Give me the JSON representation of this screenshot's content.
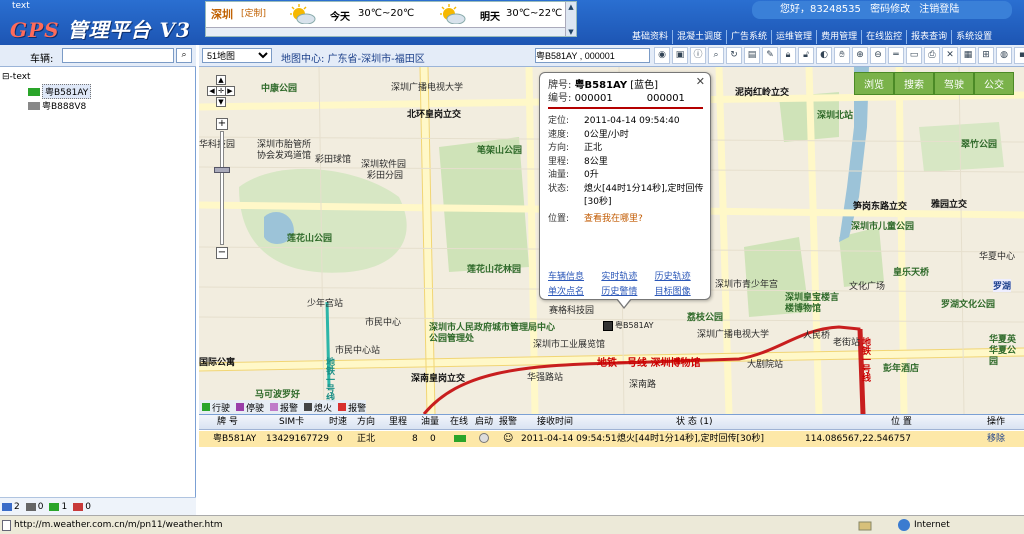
{
  "page_label": "text",
  "app": {
    "title_prefix": "GPS",
    "title_rest": " 管理平台 V3"
  },
  "weather": {
    "city": "深圳",
    "forecast_link": "[定制]",
    "today_label": "今天",
    "today_temp": "30℃~20℃",
    "tomorrow_label": "明天",
    "tomorrow_temp": "30℃~22℃"
  },
  "greeting": {
    "text": "您好，83248535",
    "change_pwd": "密码修改",
    "logout": "注销登陆"
  },
  "nav": [
    "基础资料",
    "混凝土调度",
    "广告系统",
    "运维管理",
    "费用管理",
    "在线监控",
    "报表查询",
    "系统设置"
  ],
  "sidebar": {
    "vehicle_label": "车辆:",
    "vehicle_value": "",
    "tree_root": "text",
    "vehicles": [
      {
        "plate": "粤B581AY"
      },
      {
        "plate": "粤B888V8"
      }
    ],
    "status_counts": [
      "2",
      "0",
      "1",
      "0"
    ]
  },
  "mapbar": {
    "map_type": "51地图",
    "center_label": "地图中心: 广东省-深圳市-福田区",
    "target_input": "粤B581AY , 000001"
  },
  "map_tabs": [
    "浏览",
    "搜索",
    "驾驶",
    "公交"
  ],
  "map_labels": [
    "中康公园",
    "深圳广播电视大学",
    "北环皇岗立交",
    "深圳市胎管所",
    "协会发鸡道馆",
    "彩田球馆",
    "深圳软件园",
    "彩田分园",
    "笔架山公园",
    "华科技园",
    "莲花山公园",
    "莲花山花林园",
    "少年宫站",
    "市民中心站",
    "深圳市人民政府城市管理局中心公园管理处",
    "深圳市工业展览馆",
    "赛格科技园",
    "市民中心",
    "深南皇岗立交",
    "华强路站",
    "深圳广播电视大学",
    "深圳市青少年宫",
    "荔枝公园",
    "人民桥",
    "老街站",
    "大剧院站",
    "深圳皇宝楼言楼博物馆",
    "文化广场",
    "罗湖文化公园",
    "彭年酒店",
    "泥岗红岭立交",
    "深圳北站",
    "翠竹公园",
    "笋岗东路立交",
    "雅园立交",
    "深圳市儿童公园",
    "皇乐天桥",
    "华夏中心",
    "罗湖",
    "华夏英华夏公园",
    "马可波罗好",
    "国际公寓",
    "深南路",
    "地铁一号线 深圳博物馆",
    "地铁一号线",
    "地铁一号线"
  ],
  "legend": [
    "行驶",
    "停驶",
    "报警",
    "熄火",
    "报警"
  ],
  "popup": {
    "plate_label": "牌号:",
    "plate_value": "粤B581AY",
    "plate_color": "[蓝色]",
    "number_label": "编号:",
    "number_value": "000001",
    "number_value2": "000001",
    "rows": [
      {
        "k": "定位:",
        "v": "2011-04-14 09:54:40"
      },
      {
        "k": "速度:",
        "v": "0公里/小时"
      },
      {
        "k": "方向:",
        "v": "正北"
      },
      {
        "k": "里程:",
        "v": "8公里"
      },
      {
        "k": "油量:",
        "v": "0升"
      },
      {
        "k": "状态:",
        "v": "熄火[44时1分14秒],定时回传[30秒]"
      }
    ],
    "location_label": "位置:",
    "location_link": "查看我在哪里?",
    "links": [
      "车辆信息",
      "实时轨迹",
      "历史轨迹",
      "单次点名",
      "历史警情",
      "目标图像"
    ]
  },
  "vehicle_marker": "粤B581AY",
  "table": {
    "headers": [
      "牌 号",
      "SIM卡",
      "时速",
      "方向",
      "里程",
      "油量",
      "在线",
      "启动",
      "报警",
      "接收时间",
      "状 态 (1)",
      "位 置",
      "操作"
    ],
    "rows": [
      {
        "plate": "粤B581AY",
        "sim": "13429167729",
        "speed": "0",
        "dir": "正北",
        "mileage": "8",
        "fuel": "0",
        "time": "2011-04-14 09:54:51",
        "status": "熄火[44时1分14秒],定时回传[30秒]",
        "position": "114.086567,22.546757",
        "op": "移除"
      }
    ]
  },
  "statusbar": {
    "url": "http://m.weather.com.cn/m/pn11/weather.htm",
    "zone": "Internet"
  },
  "colors": {
    "header": "#1d55b3",
    "accent_red": "#b40000",
    "row_highlight": "#fde8a8",
    "map_bg": "#f2eddf"
  }
}
